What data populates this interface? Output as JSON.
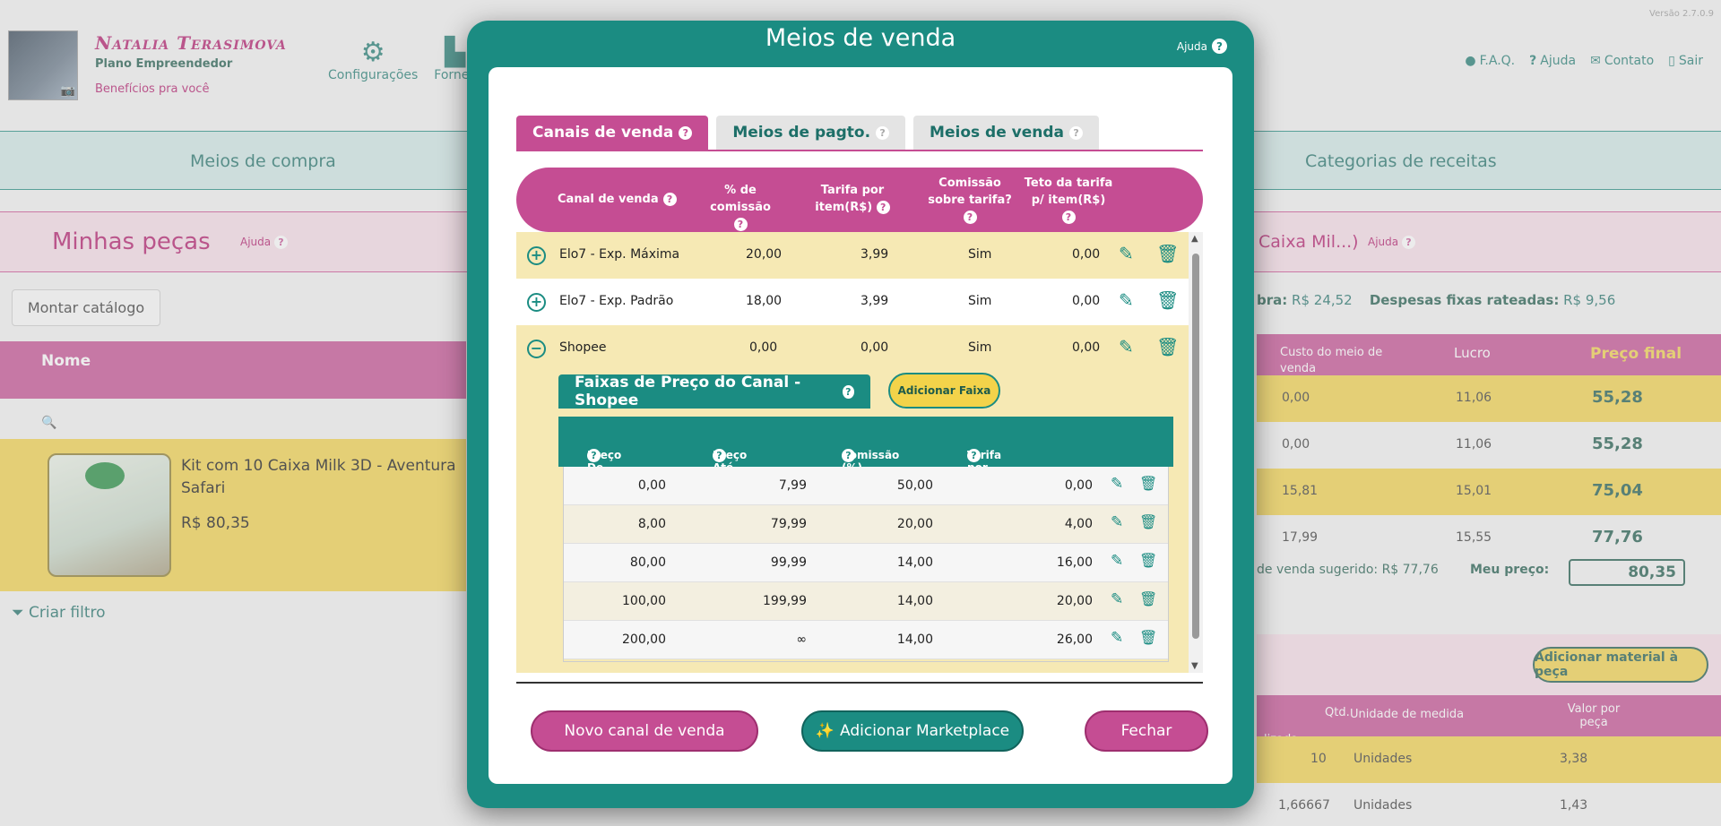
{
  "app": {
    "version": "Versão 2.7.0.9",
    "user": {
      "name": "Natalia Terasimova",
      "plan": "Plano Empreendedor",
      "benefits": "Benefícios pra você"
    },
    "top_nav": [
      {
        "label": "Configurações",
        "icon": "gears-icon"
      },
      {
        "label": "Fornec",
        "icon": "factory-icon"
      }
    ],
    "right_nav": [
      {
        "label": "F.A.Q.",
        "icon": "alert-icon"
      },
      {
        "label": "Ajuda",
        "icon": "help-icon"
      },
      {
        "label": "Contato",
        "icon": "mail-icon"
      },
      {
        "label": "Sair",
        "icon": "door-icon"
      }
    ],
    "tabs_row": {
      "left": "Meios de compra",
      "right": "Categorias de receitas"
    },
    "pecas": {
      "title": "Minhas peças",
      "ajuda": "Ajuda",
      "product_title_fragment": "Caixa Mil...)",
      "ajuda2": "Ajuda"
    },
    "catalog_button": "Montar catálogo",
    "despesas": {
      "a_label": "bra:",
      "a_value": "R$ 24,52",
      "b_label": "Despesas fixas rateadas:",
      "b_value": "R$ 9,56"
    },
    "nome_header": "Nome",
    "right_header": {
      "custo": "Custo do meio de venda",
      "lucro": "Lucro",
      "preco_final": "Preço final"
    },
    "product": {
      "name": "Kit com 10 Caixa Milk 3D - Aventura Safari",
      "price": "R$ 80,35"
    },
    "filter": "Criar filtro",
    "right_rows": [
      {
        "custo": "0,00",
        "lucro": "11,06",
        "preco": "55,28"
      },
      {
        "custo": "0,00",
        "lucro": "11,06",
        "preco": "55,28"
      },
      {
        "custo": "15,81",
        "lucro": "15,01",
        "preco": "75,04"
      },
      {
        "custo": "17,99",
        "lucro": "15,55",
        "preco": "77,76"
      }
    ],
    "sugerido": "de venda sugerido: R$ 77,76",
    "meu_preco": {
      "label": "Meu preço:",
      "value": "80,35"
    },
    "add_material": "Adicionar material à peça",
    "materials_header": {
      "qtd": "Qtd.",
      "utilizada": "lizada",
      "unidade": "Unidade de medida",
      "valor": "Valor por peça"
    },
    "materials": [
      {
        "qtd": "10",
        "unidade": "Unidades",
        "valor": "3,38"
      },
      {
        "qtd": "1,66667",
        "unidade": "Unidades",
        "valor": "1,43"
      }
    ]
  },
  "modal": {
    "title": "Meios de venda",
    "help": "Ajuda",
    "tabs": [
      {
        "label": "Canais de venda",
        "active": true
      },
      {
        "label": "Meios de pagto.",
        "active": false
      },
      {
        "label": "Meios de venda",
        "active": false
      }
    ],
    "columns": {
      "canal": "Canal de venda",
      "comissao": "% de comissão",
      "tarifa": "Tarifa por item(R$)",
      "comissao_tarifa": "Comissão sobre tarifa?",
      "teto": "Teto da tarifa p/ item(R$)"
    },
    "channels": [
      {
        "name": "Elo7 - Exp. Máxima",
        "comissao": "20,00",
        "tarifa": "3,99",
        "sobre": "Sim",
        "teto": "0,00",
        "expanded": false
      },
      {
        "name": "Elo7 - Exp. Padrão",
        "comissao": "18,00",
        "tarifa": "3,99",
        "sobre": "Sim",
        "teto": "0,00",
        "expanded": false
      },
      {
        "name": "Shopee",
        "comissao": "0,00",
        "tarifa": "0,00",
        "sobre": "Sim",
        "teto": "0,00",
        "expanded": true
      }
    ],
    "faixas": {
      "title": "Faixas de Preço do Canal - Shopee",
      "add_button": "Adicionar Faixa",
      "columns": {
        "de": "Preço De (R$)",
        "ate": "Preço Até (R$)",
        "comissao": "Comissão (%)",
        "tarifa": "Tarifa por Item (R$)"
      },
      "rows": [
        {
          "de": "0,00",
          "ate": "7,99",
          "comissao": "50,00",
          "tarifa": "0,00"
        },
        {
          "de": "8,00",
          "ate": "79,99",
          "comissao": "20,00",
          "tarifa": "4,00"
        },
        {
          "de": "80,00",
          "ate": "99,99",
          "comissao": "14,00",
          "tarifa": "16,00"
        },
        {
          "de": "100,00",
          "ate": "199,99",
          "comissao": "14,00",
          "tarifa": "20,00"
        },
        {
          "de": "200,00",
          "ate": "∞",
          "comissao": "14,00",
          "tarifa": "26,00"
        }
      ]
    },
    "buttons": {
      "novo": "Novo canal de venda",
      "marketplace": "Adicionar Marketplace",
      "fechar": "Fechar"
    }
  },
  "colors": {
    "teal": "#1b8c82",
    "pink": "#c54d93",
    "yellow": "#f3d34a",
    "row_yellow": "#f6e9b4"
  }
}
